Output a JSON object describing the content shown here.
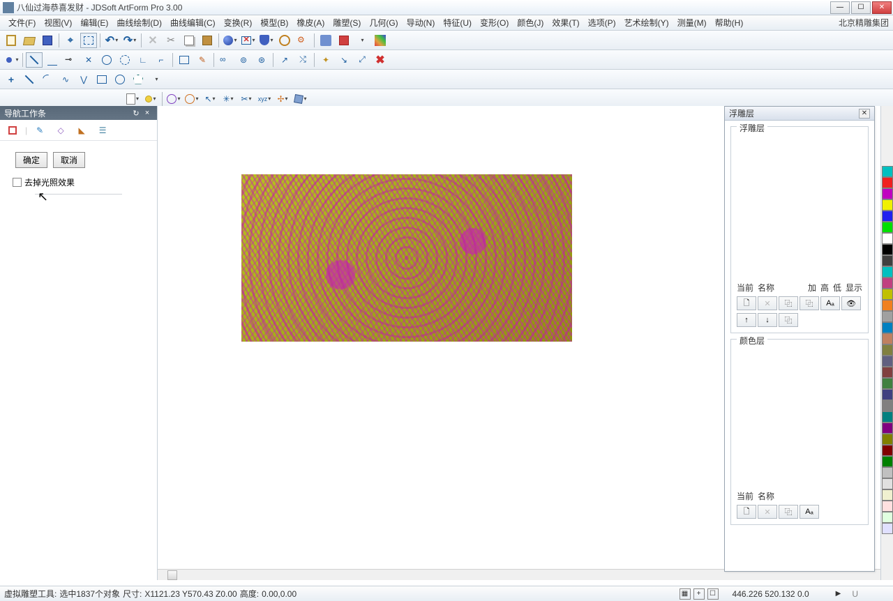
{
  "title": "八仙过海恭喜发财 - JDSoft ArtForm Pro 3.00",
  "menu": {
    "file": "文件(F)",
    "view": "视图(V)",
    "edit": "编辑(E)",
    "curvedraw": "曲线绘制(D)",
    "curveedit": "曲线编辑(C)",
    "transform": "变换(R)",
    "model": "模型(B)",
    "eraser": "橡皮(A)",
    "sculpt": "雕塑(S)",
    "geom": "几何(G)",
    "deriv": "导动(N)",
    "feature": "特征(U)",
    "deform": "变形(O)",
    "color": "颜色(J)",
    "effect": "效果(T)",
    "option": "选项(P)",
    "artdraw": "艺术绘制(Y)",
    "measure": "测量(M)",
    "help": "帮助(H)"
  },
  "company": "北京精雕集团",
  "nav_panel": {
    "title": "导航工作条",
    "ok": "确定",
    "cancel": "取消",
    "checkbox_label": "去掉光照效果"
  },
  "relief_panel": {
    "title": "浮雕层",
    "group1": "浮雕层",
    "cols": {
      "current": "当前",
      "name": "名称",
      "add": "加",
      "high": "高",
      "low": "低",
      "show": "显示"
    },
    "group2": "颜色层",
    "cols2": {
      "current": "当前",
      "name": "名称"
    }
  },
  "statusbar": {
    "tool": "虚拟雕塑工具:",
    "selection": "选中1837个对象",
    "size_label": "尺寸:",
    "size": "X1121.23 Y570.43 Z0.00",
    "height_label": "高度:",
    "height": "0.00,0.00",
    "coords": "446.226 520.132 0.0",
    "scroll_arrow": "▶",
    "scroll_u": "U"
  },
  "palette": [
    "#00c0c0",
    "#f02020",
    "#c000c0",
    "#f0f000",
    "#2020f0",
    "#00e000",
    "#ffffff",
    "#000000",
    "#404040",
    "#00c0c0",
    "#c04080",
    "#c0c000",
    "#f08020",
    "#a0a0a0",
    "#0080c0",
    "#c08060",
    "#808040",
    "#606080",
    "#804040",
    "#408040",
    "#404080",
    "#808080",
    "#008080",
    "#800080",
    "#808000",
    "#800000",
    "#008000",
    "#c0c0c0",
    "#e0e0e0",
    "#f0f0d0",
    "#ffe0e0",
    "#e0ffe0",
    "#e0e0ff"
  ]
}
